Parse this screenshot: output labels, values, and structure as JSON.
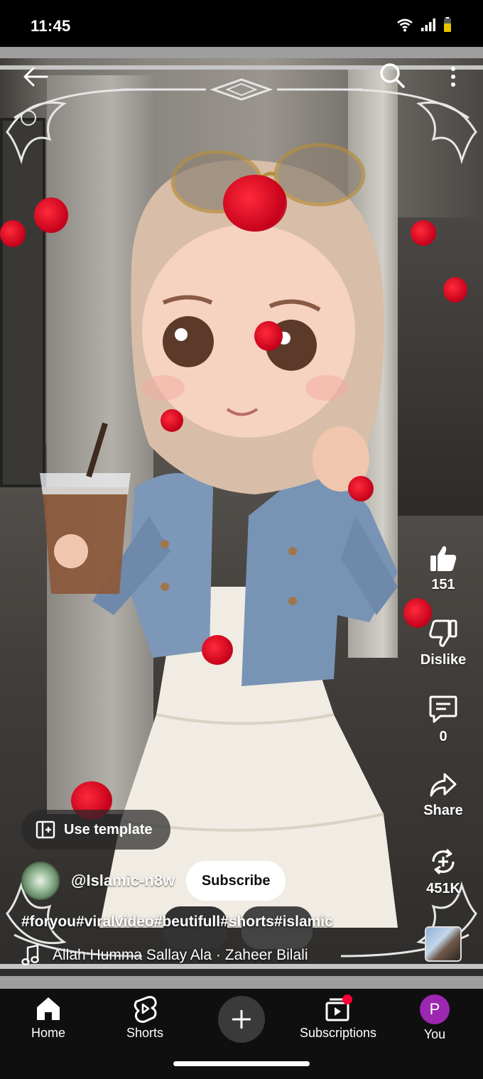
{
  "status_bar": {
    "time": "11:45"
  },
  "video": {
    "controls": {
      "back_icon": "arrow-left-icon",
      "search_icon": "search-icon",
      "menu_icon": "more-vert-icon"
    }
  },
  "actions": {
    "like": {
      "icon": "thumb-up-icon",
      "label": "151"
    },
    "dislike": {
      "icon": "thumb-down-icon",
      "label": "Dislike"
    },
    "comments": {
      "icon": "comment-icon",
      "label": "0"
    },
    "share": {
      "icon": "share-icon",
      "label": "Share"
    },
    "remix": {
      "icon": "remix-icon",
      "label": "451K"
    }
  },
  "use_template": {
    "label": "Use template"
  },
  "channel": {
    "name": "@Islamic-n8w",
    "subscribe_label": "Subscribe"
  },
  "hashtags": "#foryou#viralvideo#beutifull#shorts#islamic",
  "music": {
    "icon": "music-note-icon",
    "title": "Allah Humma Sallay Ala · Zaheer Bilali"
  },
  "bottom_nav": {
    "items": [
      {
        "label": "Home",
        "icon": "home-icon"
      },
      {
        "label": "Shorts",
        "icon": "shorts-icon"
      },
      {
        "label": "",
        "icon": "plus-icon"
      },
      {
        "label": "Subscriptions",
        "icon": "subscriptions-icon"
      },
      {
        "label": "You",
        "icon": "avatar"
      }
    ],
    "you_initial": "P",
    "subscriptions_dot_color": "#ff0033"
  },
  "colors": {
    "petal": "#e0001b",
    "nav_bg": "#0f0f0f",
    "avatar": "#9c27b0"
  }
}
